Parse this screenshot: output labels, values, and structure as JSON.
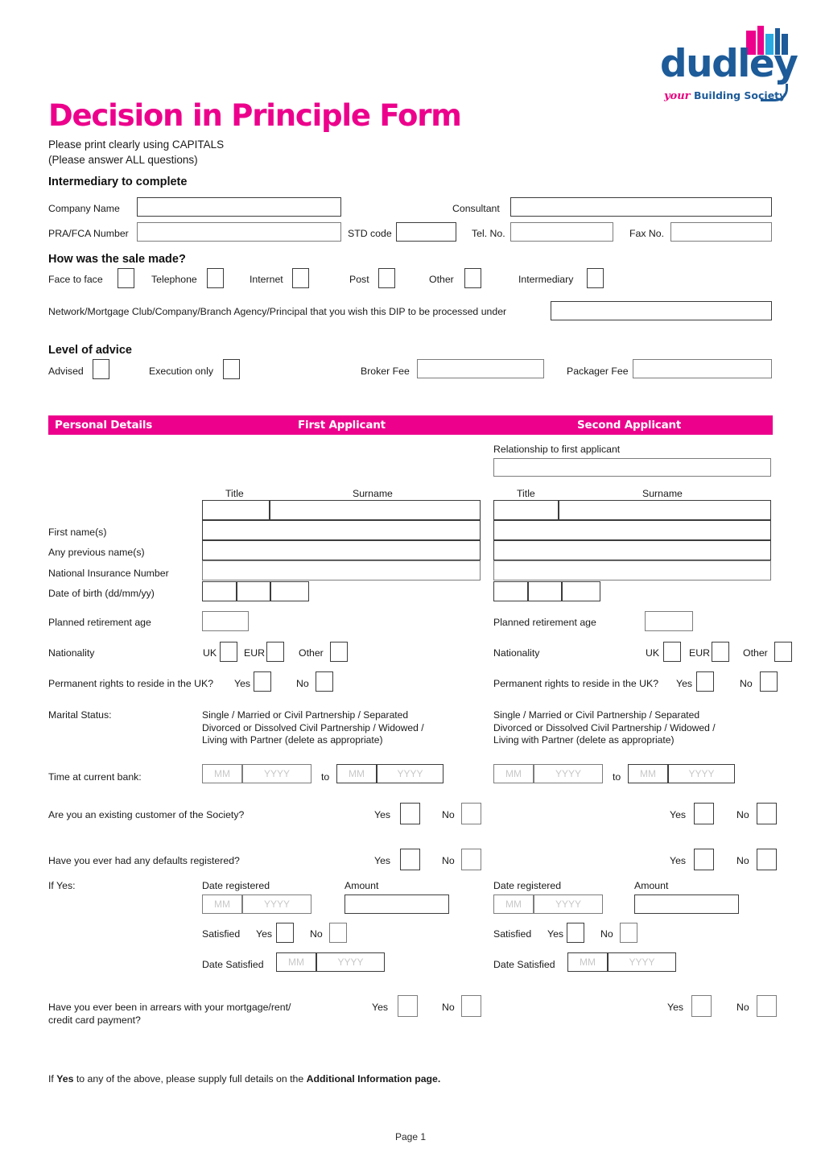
{
  "brand": {
    "logo_word": "dudley",
    "tagline_your": "your",
    "tagline_rest": "Building Society",
    "pink": "#EC008C",
    "blue": "#1D5B99",
    "lightblue": "#29ABE2"
  },
  "header": {
    "title": "Decision in Principle Form",
    "subtitle_1": "Please print clearly using CAPITALS",
    "subtitle_2": "(Please answer ALL questions)"
  },
  "intermediary": {
    "heading": "Intermediary to complete",
    "company_name_label": "Company Name",
    "consultant_label": "Consultant",
    "pra_fca_label": "PRA/FCA Number",
    "std_code_label": "STD code",
    "tel_no_label": "Tel. No.",
    "fax_no_label": "Fax No.",
    "company_name_value": "",
    "consultant_value": "",
    "pra_fca_value": "",
    "std_code_value": "",
    "tel_no_value": "",
    "fax_no_value": ""
  },
  "sale_made": {
    "heading": "How was the sale made?",
    "options": [
      {
        "label": "Face to face",
        "checked": false
      },
      {
        "label": "Telephone",
        "checked": false
      },
      {
        "label": "Internet",
        "checked": false
      },
      {
        "label": "Post",
        "checked": false
      },
      {
        "label": "Other",
        "checked": false
      },
      {
        "label": "Intermediary",
        "checked": false
      }
    ],
    "network_label": "Network/Mortgage Club/Company/Branch Agency/Principal that you wish this DIP to be processed under",
    "network_value": ""
  },
  "level_of_advice": {
    "heading": "Level of advice",
    "advised_label": "Advised",
    "execution_only_label": "Execution only",
    "broker_fee_label": "Broker Fee",
    "packager_fee_label": "Packager Fee",
    "advised_checked": false,
    "execution_only_checked": false,
    "broker_fee_value": "",
    "packager_fee_value": ""
  },
  "personal_details": {
    "band_left": "Personal Details",
    "band_mid": "First Applicant",
    "band_right": "Second Applicant",
    "relationship_label": "Relationship to first applicant",
    "relationship_value": "",
    "title_col": "Title",
    "surname_col": "Surname",
    "rows": [
      {
        "label": "First name(s)",
        "a1": "",
        "a2": ""
      },
      {
        "label": "Any  previous name(s)",
        "a1": "",
        "a2": ""
      },
      {
        "label": "National Insurance Number",
        "a1": "",
        "a2": ""
      },
      {
        "label": "Date of birth (dd/mm/yy)",
        "a1": "",
        "a2": ""
      }
    ],
    "title_a1": "",
    "surname_a1": "",
    "title_a2": "",
    "surname_a2": "",
    "planned_retirement_label": "Planned retirement age",
    "planned_retirement_a1": "",
    "planned_retirement_a2": "",
    "nationality_label": "Nationality",
    "nationality_options": [
      "UK",
      "EUR",
      "Other"
    ],
    "permanent_rights_label": "Permanent rights to reside in the UK?",
    "yes_label": "Yes",
    "no_label": "No",
    "marital_status_label": "Marital Status:",
    "marital_status_lines": [
      "Single / Married or Civil Partnership / Separated",
      "Divorced or Dissolved Civil Partnership / Widowed /",
      "Living with Partner (delete as appropriate)"
    ],
    "time_at_bank_label": "Time at current bank:",
    "to_label": "to",
    "mm_placeholder": "MM",
    "yyyy_placeholder": "YYYY",
    "existing_customer_label": "Are you an existing customer of the Society?",
    "defaults_label": "Have you ever had any defaults registered?",
    "if_yes_label": "If Yes:",
    "date_registered_label": "Date registered",
    "amount_label": "Amount",
    "amount_a1": "",
    "amount_a2": "",
    "satisfied_label": "Satisfied",
    "date_satisfied_label": "Date Satisfied",
    "arrears_line_1": "Have you ever been in arrears with your mortgage/rent/",
    "arrears_line_2": "credit card payment?"
  },
  "footnote": {
    "pre": "If ",
    "bold_1": "Yes",
    "mid": " to any of the above, please supply full details on the ",
    "bold_2": "Additional Information page."
  },
  "footer": {
    "page": "Page 1"
  }
}
